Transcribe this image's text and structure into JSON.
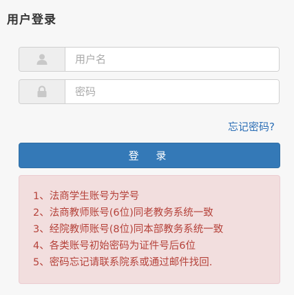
{
  "header": {
    "title": "用户登录"
  },
  "form": {
    "username": {
      "placeholder": "用户名",
      "value": "",
      "icon": "user-icon"
    },
    "password": {
      "placeholder": "密码",
      "value": "",
      "icon": "lock-icon"
    },
    "forgot_link": "忘记密码?",
    "login_label": "登 录"
  },
  "notice": {
    "items": [
      "1、法商学生账号为学号",
      "2、法商教师账号(6位)同老教务系统一致",
      "3、经院教师账号(8位)同本部教务系统一致",
      "4、各类账号初始密码为证件号后6位",
      "5、密码忘记请联系院系或通过邮件找回."
    ]
  },
  "colors": {
    "primary": "#3479b7",
    "link": "#2a6db5",
    "notice_bg": "#f2dede",
    "notice_text": "#b5423a"
  }
}
